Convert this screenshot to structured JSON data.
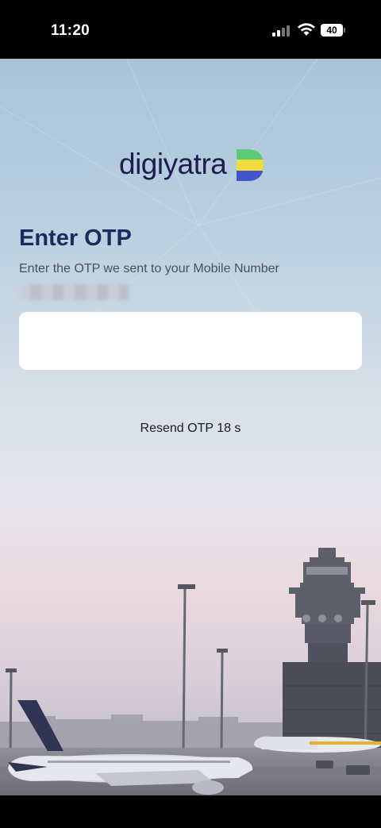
{
  "status_bar": {
    "time": "11:20",
    "battery_level": "40",
    "icons": [
      "cellular-signal-icon",
      "wifi-icon",
      "battery-icon"
    ]
  },
  "brand": {
    "logo_text": "digiyatra",
    "colors": {
      "text": "#1d1d4d",
      "mark_green": "#5ec97a",
      "mark_yellow": "#f0dc3c",
      "mark_blue": "#3f55c9"
    }
  },
  "otp": {
    "title": "Enter OTP",
    "subtitle": "Enter the OTP we sent to your Mobile Number",
    "input_value": "",
    "resend_text": "Resend OTP 18 s"
  },
  "colors": {
    "title": "#1a2a5a",
    "input_bg": "#ffffff"
  }
}
